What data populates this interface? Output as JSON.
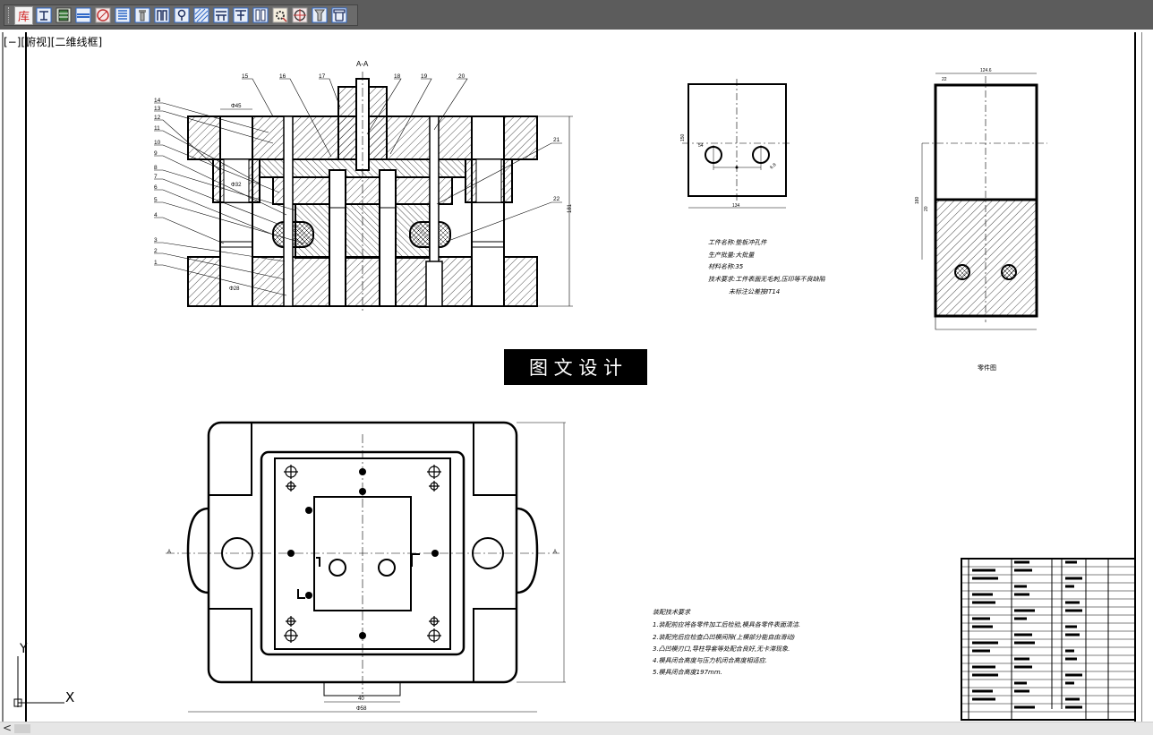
{
  "toolbar": {
    "buttons": [
      {
        "name": "library-button",
        "label": "库",
        "icon": "library-icon"
      },
      {
        "name": "view-front-button",
        "icon": "view-front-icon"
      },
      {
        "name": "block-button",
        "icon": "block-icon"
      },
      {
        "name": "hatch-line-button",
        "icon": "hatch-line-icon"
      },
      {
        "name": "circle-cross-button",
        "icon": "circle-cross-icon"
      },
      {
        "name": "thread-button",
        "icon": "thread-icon"
      },
      {
        "name": "bolt-button",
        "icon": "bolt-icon"
      },
      {
        "name": "bracket-button",
        "icon": "bracket-icon"
      },
      {
        "name": "pin-button",
        "icon": "pin-icon"
      },
      {
        "name": "diagonal-hatch-button",
        "icon": "diagonal-hatch-icon"
      },
      {
        "name": "section-button",
        "icon": "section-icon"
      },
      {
        "name": "tee-button",
        "icon": "tee-icon"
      },
      {
        "name": "double-column-button",
        "icon": "double-column-icon"
      },
      {
        "name": "gear-dimension-button",
        "icon": "gear-dimension-icon"
      },
      {
        "name": "target-button",
        "icon": "target-icon"
      },
      {
        "name": "screw-button",
        "icon": "screw-icon"
      },
      {
        "name": "frame-button",
        "icon": "frame-icon"
      }
    ],
    "colors": {
      "bar": "#5c5c5c",
      "library": "#d02020",
      "icon_blue": "#2f68c8"
    }
  },
  "viewport": {
    "label": "[−][俯视][二维线框]"
  },
  "drawing": {
    "section_title": "A-A",
    "part_numbers": [
      "15",
      "16",
      "17",
      "18",
      "19",
      "20",
      "14",
      "13",
      "12",
      "11",
      "10",
      "9",
      "8",
      "7",
      "6",
      "5",
      "4",
      "3",
      "2",
      "1",
      "21",
      "22"
    ],
    "dim_labels": {
      "top_width": "Φ45",
      "height": "181",
      "left_dia": "Φ32",
      "bottom_dia": "Φ28",
      "part_width": "134",
      "part_height": "150",
      "piece_dim": "124.6",
      "hole_spacing": "54",
      "bottom_width": "40",
      "overall": "Φ58",
      "small_a": "6.8",
      "small_b": "20",
      "small_c": "22",
      "plan_height": "180",
      "side_left": "A",
      "side_right": "A"
    },
    "part_info": [
      "工件名称:垫板冲孔件",
      "生产批量:大批量",
      "材料名称:35",
      "技术要求:工件表面无毛刺,压印等不良缺陷",
      "未标注公差按IT14"
    ],
    "workpiece_caption": "零件图",
    "watermark": "图 文 设 计",
    "tech_requirements": [
      "装配技术要求",
      "1.装配前应将各零件加工后检验,模具各零件表面清洁.",
      "2.装配完后应检查凸凹模间隙(上模部分能自由滑动)",
      "3.凸凹模刃口,导柱导套等处配合良好,无卡滞现象.",
      "4.模具闭合高度与压力机闭合高度相适应.",
      "5.模具闭合高度197mm."
    ],
    "title_block_rows": 20,
    "ucs": {
      "x": "X",
      "y": "Y"
    }
  }
}
